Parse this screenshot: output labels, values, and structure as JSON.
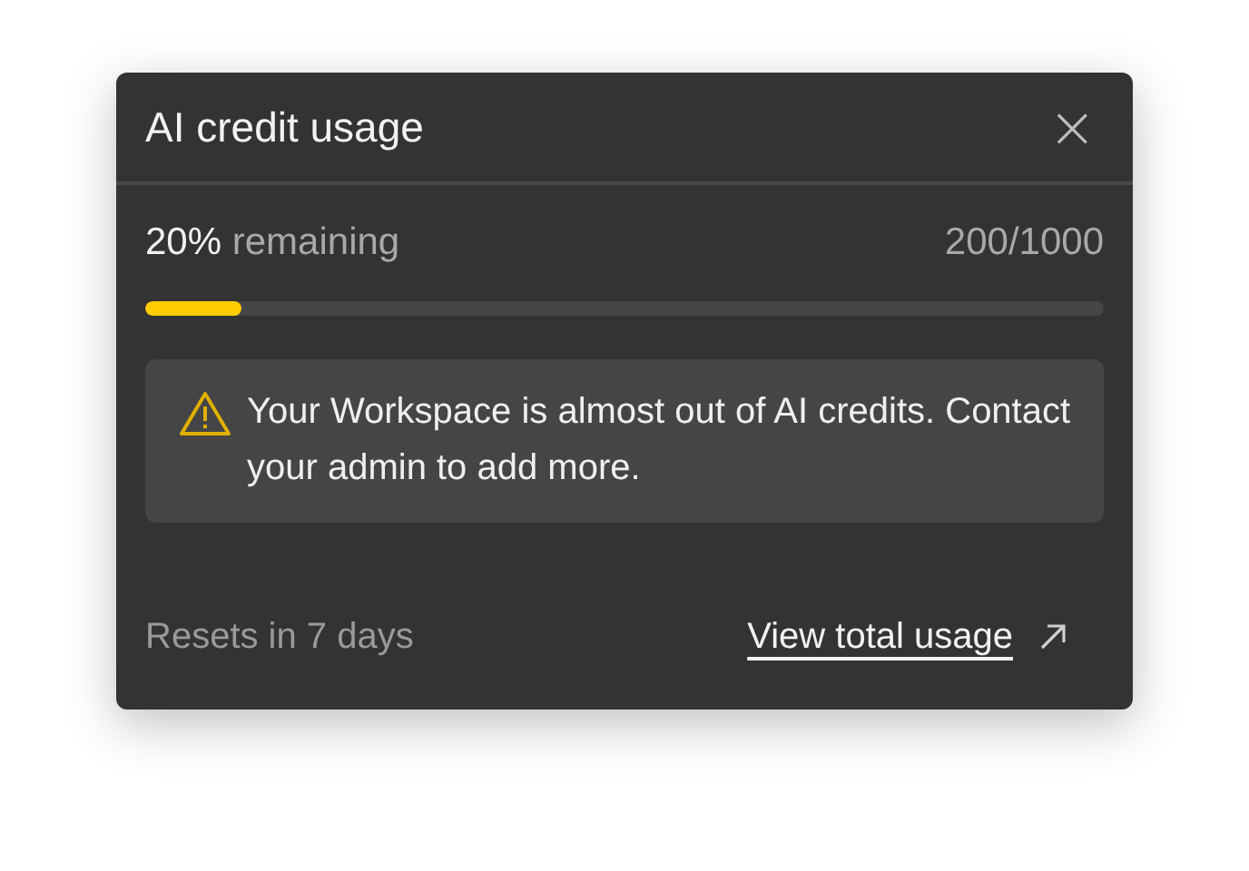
{
  "dialog": {
    "title": "AI credit usage",
    "close": "×"
  },
  "usage": {
    "percent": "20%",
    "remaining_label": "remaining",
    "count": "200/1000",
    "level": 0.1
  },
  "warning": {
    "text": "Your Workspace is almost out of AI credits. Contact your admin to add more."
  },
  "footer": {
    "resets": "Resets in 7 days",
    "link": "View total usage"
  }
}
